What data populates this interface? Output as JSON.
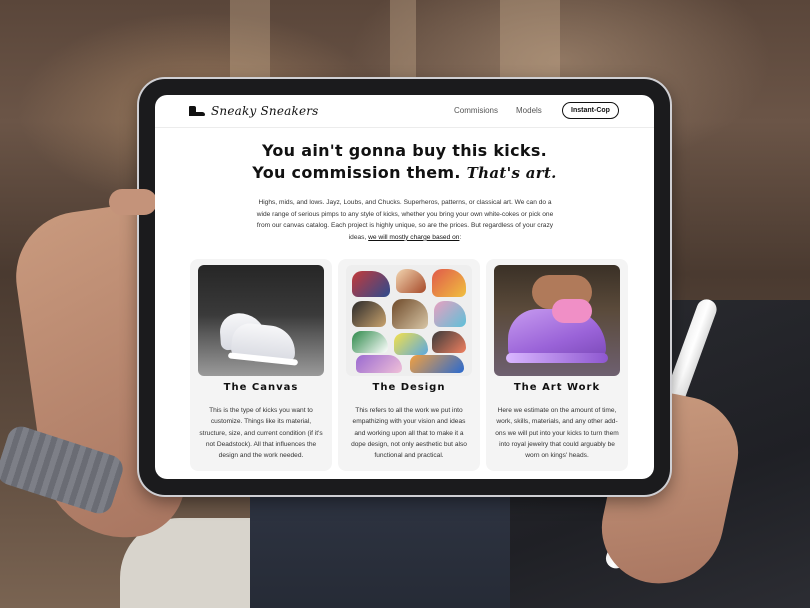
{
  "nav": {
    "logo_text": "Sneaky Sneakers",
    "links": [
      "Commisions",
      "Models"
    ],
    "cta_label": "Instant-Cop"
  },
  "hero": {
    "line1": "You ain't gonna buy this kicks.",
    "line2": "You commission them.",
    "accent": "That's art.",
    "intro": "Highs, mids, and lows. Jayz, Loubs, and Chucks. Superheros, patterns, or classical art. We can do a wide range of serious pimps to any style of kicks, whether you bring your own white-cokes or pick one from our canvas catalog. Each project is highly unique, so are the prices. But regardless of your crazy ideas,",
    "intro_link": "we will mostly charge based on",
    "intro_end": ":"
  },
  "cards": [
    {
      "title": "The Canvas",
      "description": "This is the type of kicks you want to customize. Things like its material, structure, size, and current condition (if it's not Deadstock). All that influences the design and the work needed."
    },
    {
      "title": "The Design",
      "description": "This refers to all the work we put into empathizing with your vision and ideas and working upon all that to make it a dope design, not only aesthetic but also functional and practical."
    },
    {
      "title": "The Art Work",
      "description": "Here we estimate on the amount of time, work, skills, materials, and any other add-ons we will put into your kicks to turn them into royal jewelry that could arguably be worn on kings' heads."
    }
  ],
  "colors": {
    "page_bg": "#ffffff",
    "card_bg": "#f4f4f4",
    "text_dark": "#111111",
    "text_body": "#333333"
  },
  "icons": {
    "logo": "sneaker-icon"
  }
}
